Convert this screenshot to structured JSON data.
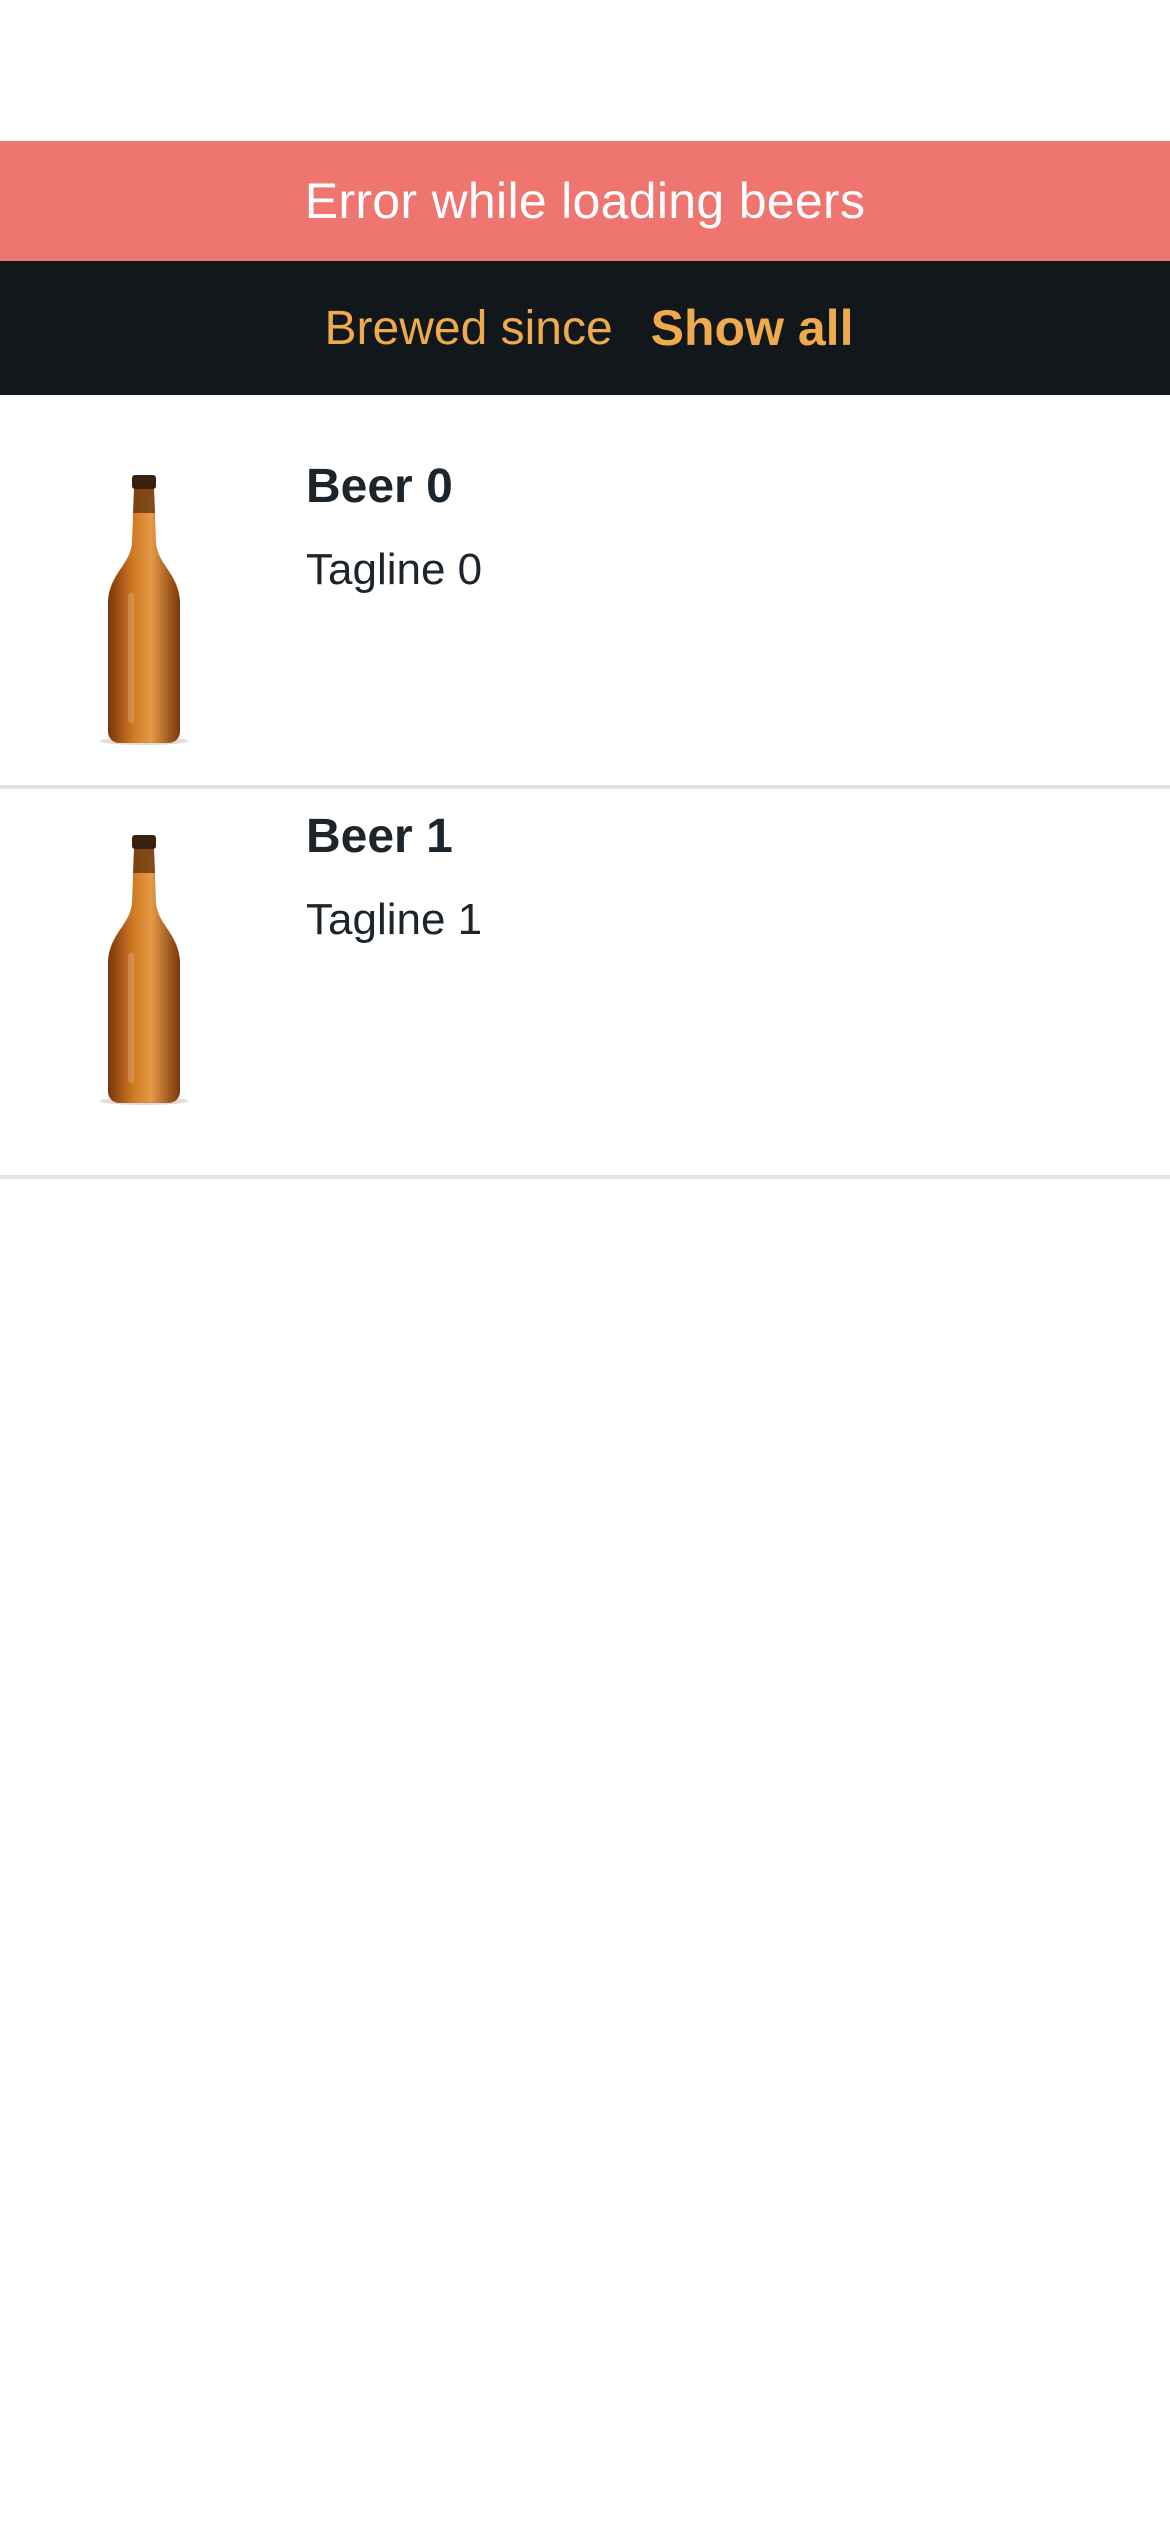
{
  "error_banner": {
    "text": "Error while loading beers",
    "color": "#ee7570"
  },
  "filter_bar": {
    "options": [
      {
        "label": "Brewed since",
        "selected": false
      },
      {
        "label": "Show all",
        "selected": true
      }
    ],
    "accent_color": "#eeaa4c",
    "background": "#11171b"
  },
  "beers": [
    {
      "name": "Beer 0",
      "tagline": "Tagline 0",
      "image_icon": "beer-bottle-image"
    },
    {
      "name": "Beer 1",
      "tagline": "Tagline 1",
      "image_icon": "beer-bottle-image"
    }
  ]
}
